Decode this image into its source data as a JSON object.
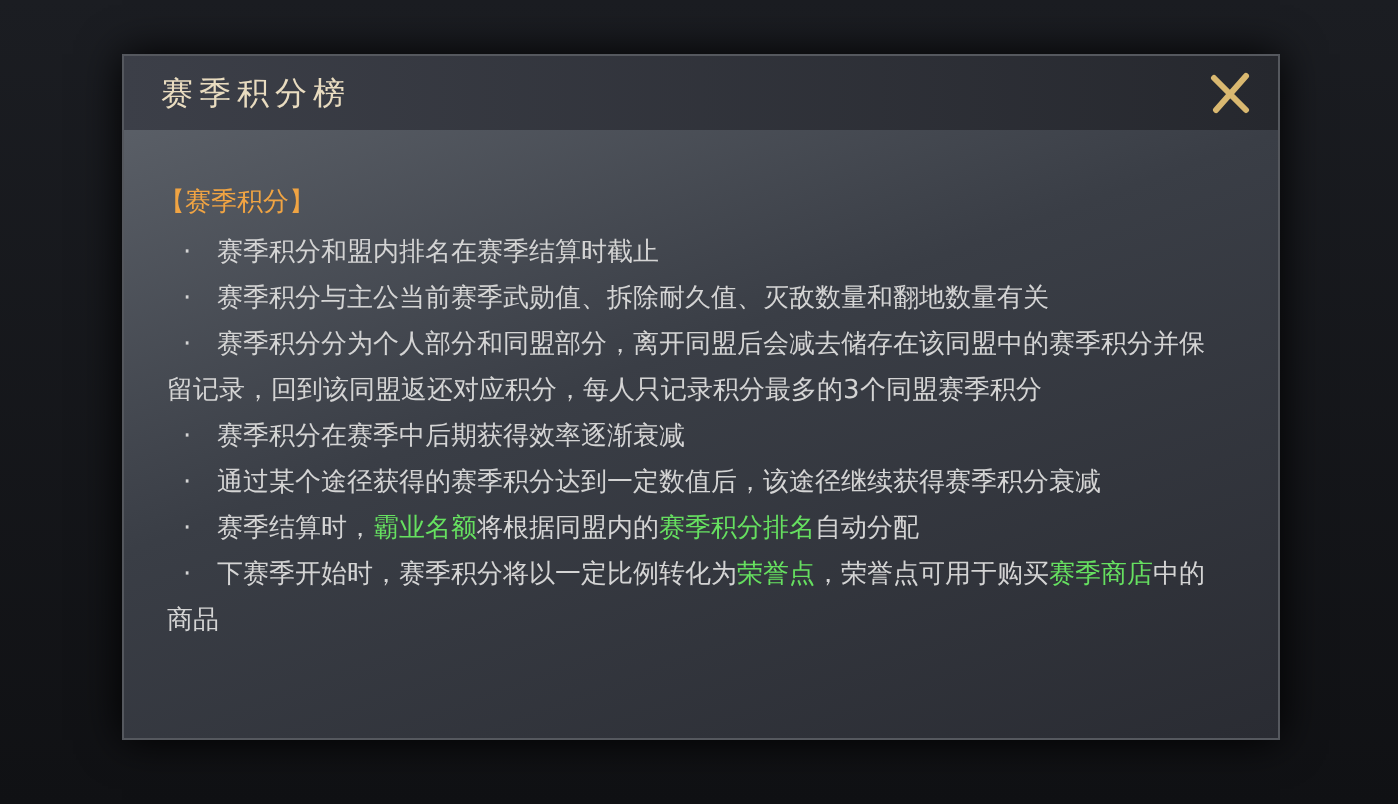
{
  "dialog": {
    "title": "赛季积分榜",
    "section_heading": "【赛季积分】",
    "paragraphs": [
      {
        "bullet": "·",
        "segments": [
          {
            "text": "赛季积分和盟内排名在赛季结算时截止",
            "highlight": false
          }
        ]
      },
      {
        "bullet": "·",
        "segments": [
          {
            "text": "赛季积分与主公当前赛季武勋值、拆除耐久值、灭敌数量和翻地数量有关",
            "highlight": false
          }
        ]
      },
      {
        "bullet": "·",
        "segments": [
          {
            "text": "赛季积分分为个人部分和同盟部分，离开同盟后会减去储存在该同盟中的赛季积分并保留记录，回到该同盟返还对应积分，每人只记录积分最多的3个同盟赛季积分",
            "highlight": false
          }
        ]
      },
      {
        "bullet": "·",
        "segments": [
          {
            "text": "赛季积分在赛季中后期获得效率逐渐衰减",
            "highlight": false
          }
        ]
      },
      {
        "bullet": "·",
        "segments": [
          {
            "text": "通过某个途径获得的赛季积分达到一定数值后，该途径继续获得赛季积分衰减",
            "highlight": false
          }
        ]
      },
      {
        "bullet": "·",
        "segments": [
          {
            "text": "赛季结算时，",
            "highlight": false
          },
          {
            "text": "霸业名额",
            "highlight": true
          },
          {
            "text": "将根据同盟内的",
            "highlight": false
          },
          {
            "text": "赛季积分排名",
            "highlight": true
          },
          {
            "text": "自动分配",
            "highlight": false
          }
        ]
      },
      {
        "bullet": "·",
        "segments": [
          {
            "text": "下赛季开始时，赛季积分将以一定比例转化为",
            "highlight": false
          },
          {
            "text": "荣誉点",
            "highlight": true
          },
          {
            "text": "，荣誉点可用于购买",
            "highlight": false
          },
          {
            "text": "赛季商店",
            "highlight": true
          },
          {
            "text": "中的商品",
            "highlight": false
          }
        ]
      }
    ]
  }
}
